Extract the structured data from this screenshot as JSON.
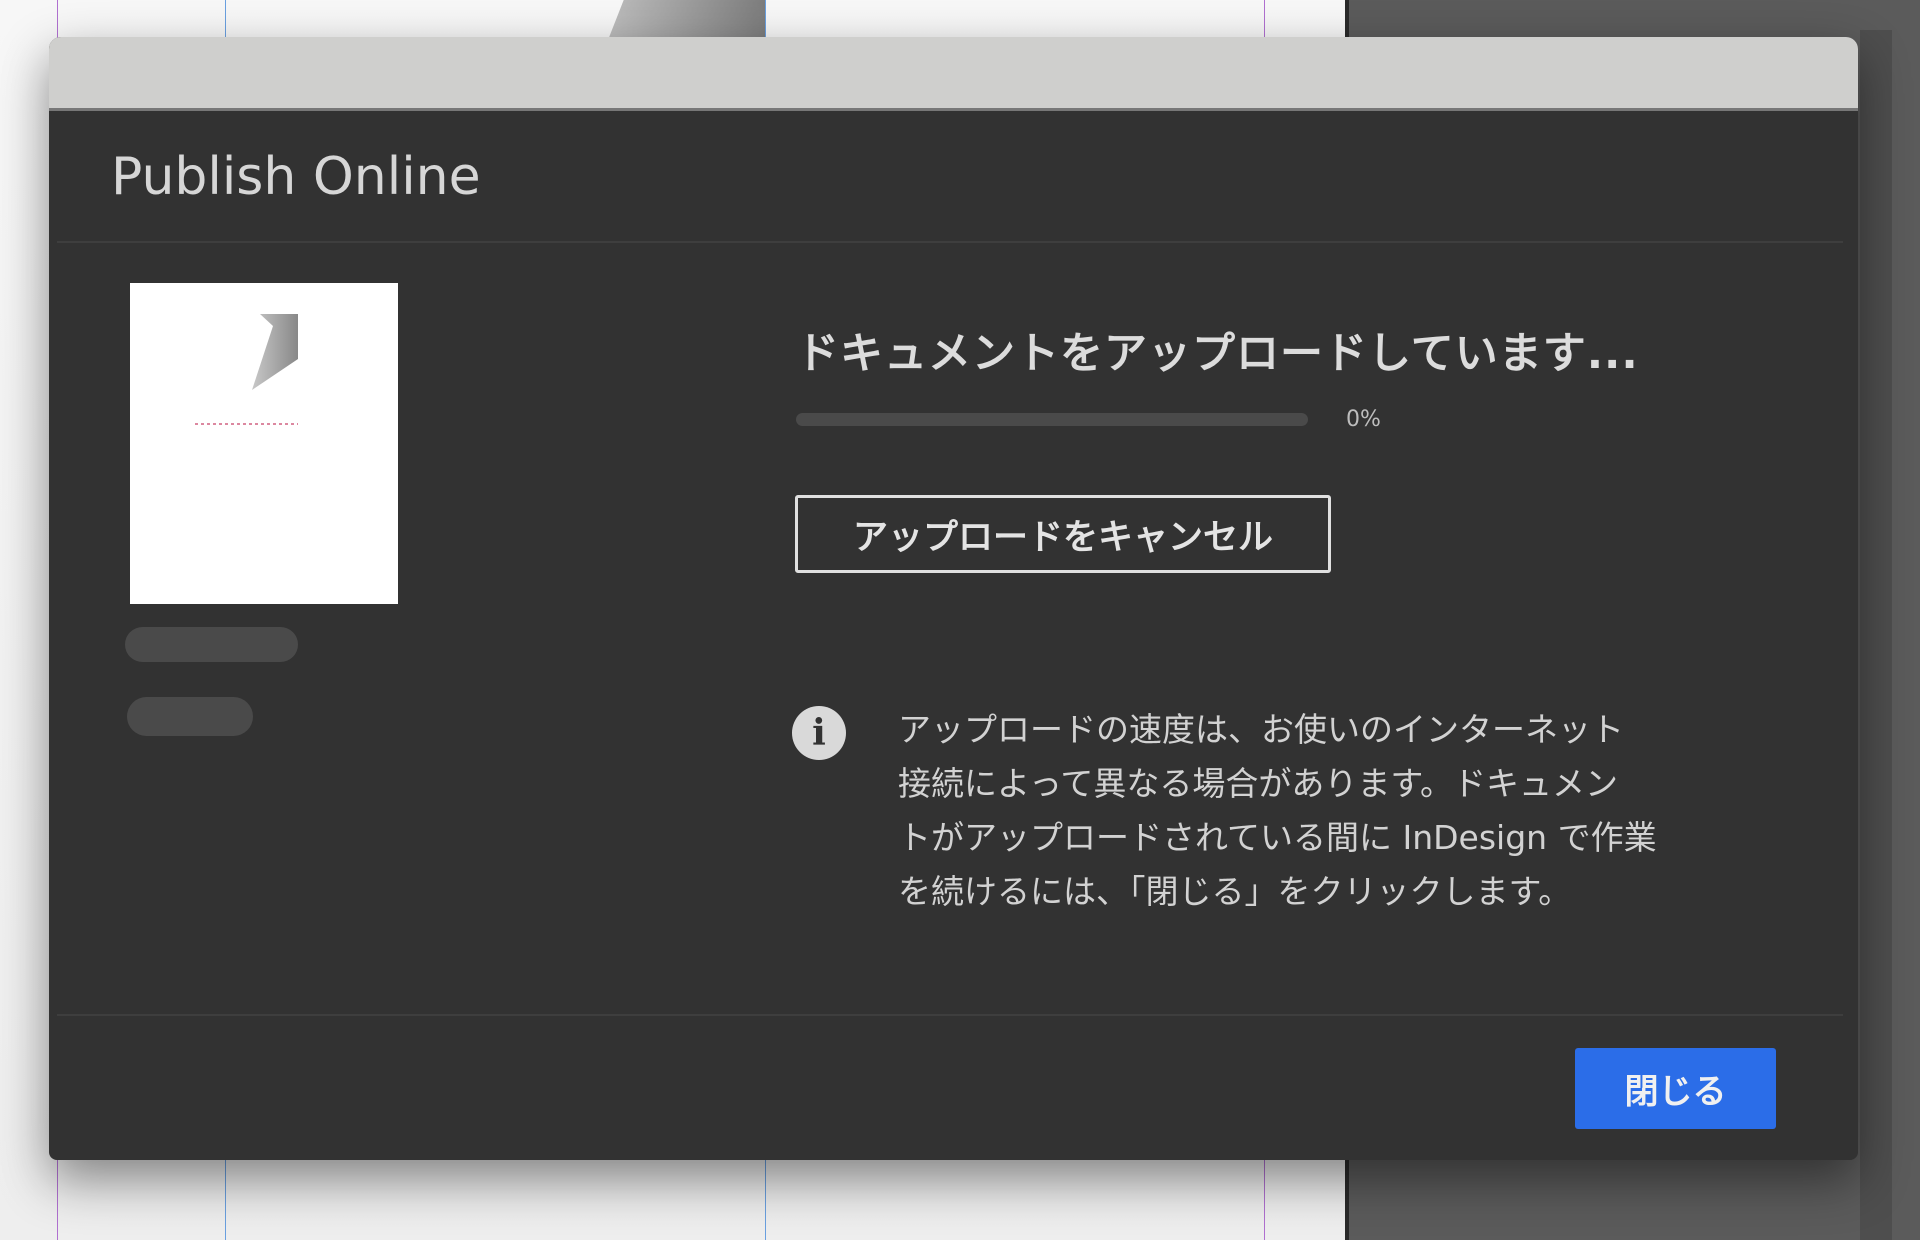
{
  "dialog": {
    "title": "Publish Online",
    "status_heading": "ドキュメントをアップロードしています...",
    "progress": {
      "percent": 0,
      "label": "0%"
    },
    "cancel_button": "アップロードをキャンセル",
    "info_lines": [
      "アップロードの速度は、お使いのインターネット",
      "接続によって異なる場合があります。ドキュメン",
      "トがアップロードされている間に InDesign で作業",
      "を続けるには、「閉じる」をクリックします。"
    ],
    "close_button": "閉じる"
  },
  "colors": {
    "accent": "#2b6de8",
    "dialog_bg": "#323232",
    "titlebar": "#cfcfcd"
  }
}
